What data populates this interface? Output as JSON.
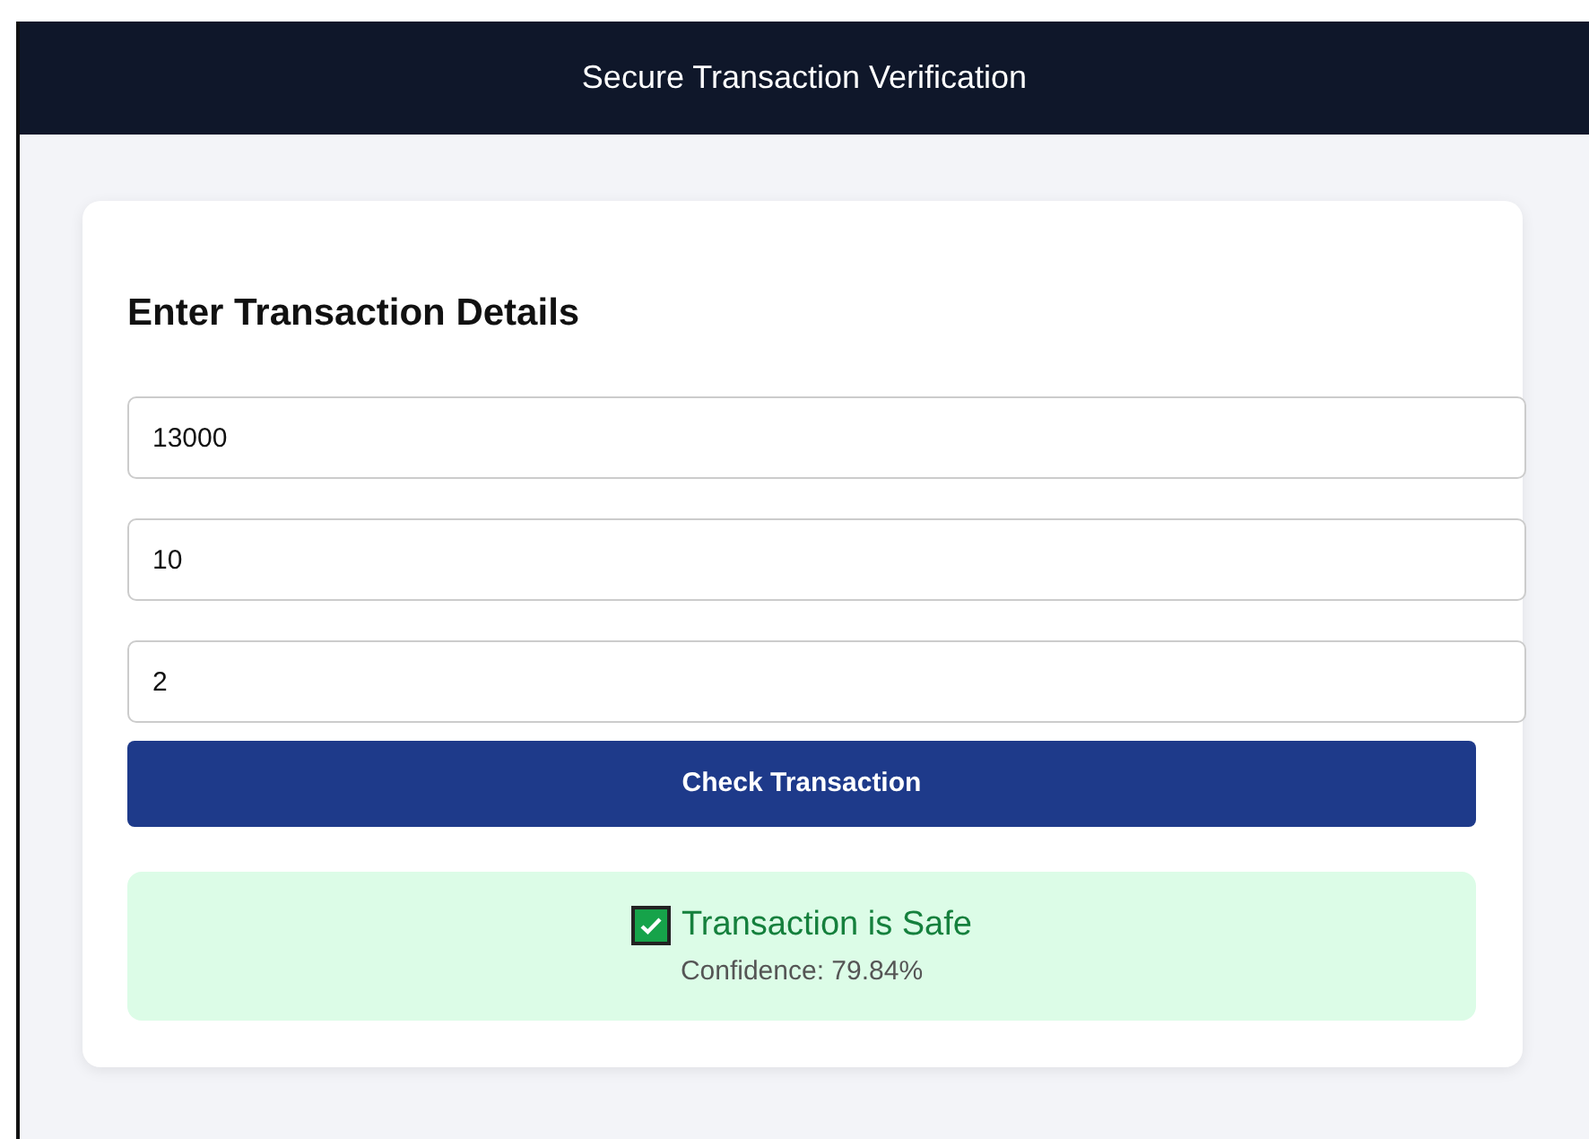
{
  "header": {
    "title": "Secure Transaction Verification"
  },
  "form": {
    "heading": "Enter Transaction Details",
    "fields": [
      {
        "value": "13000"
      },
      {
        "value": "10"
      },
      {
        "value": "2"
      }
    ],
    "button": "Check Transaction"
  },
  "result": {
    "kind": "safe",
    "message": "Transaction is Safe",
    "confidence": "Confidence: 79.84%"
  }
}
